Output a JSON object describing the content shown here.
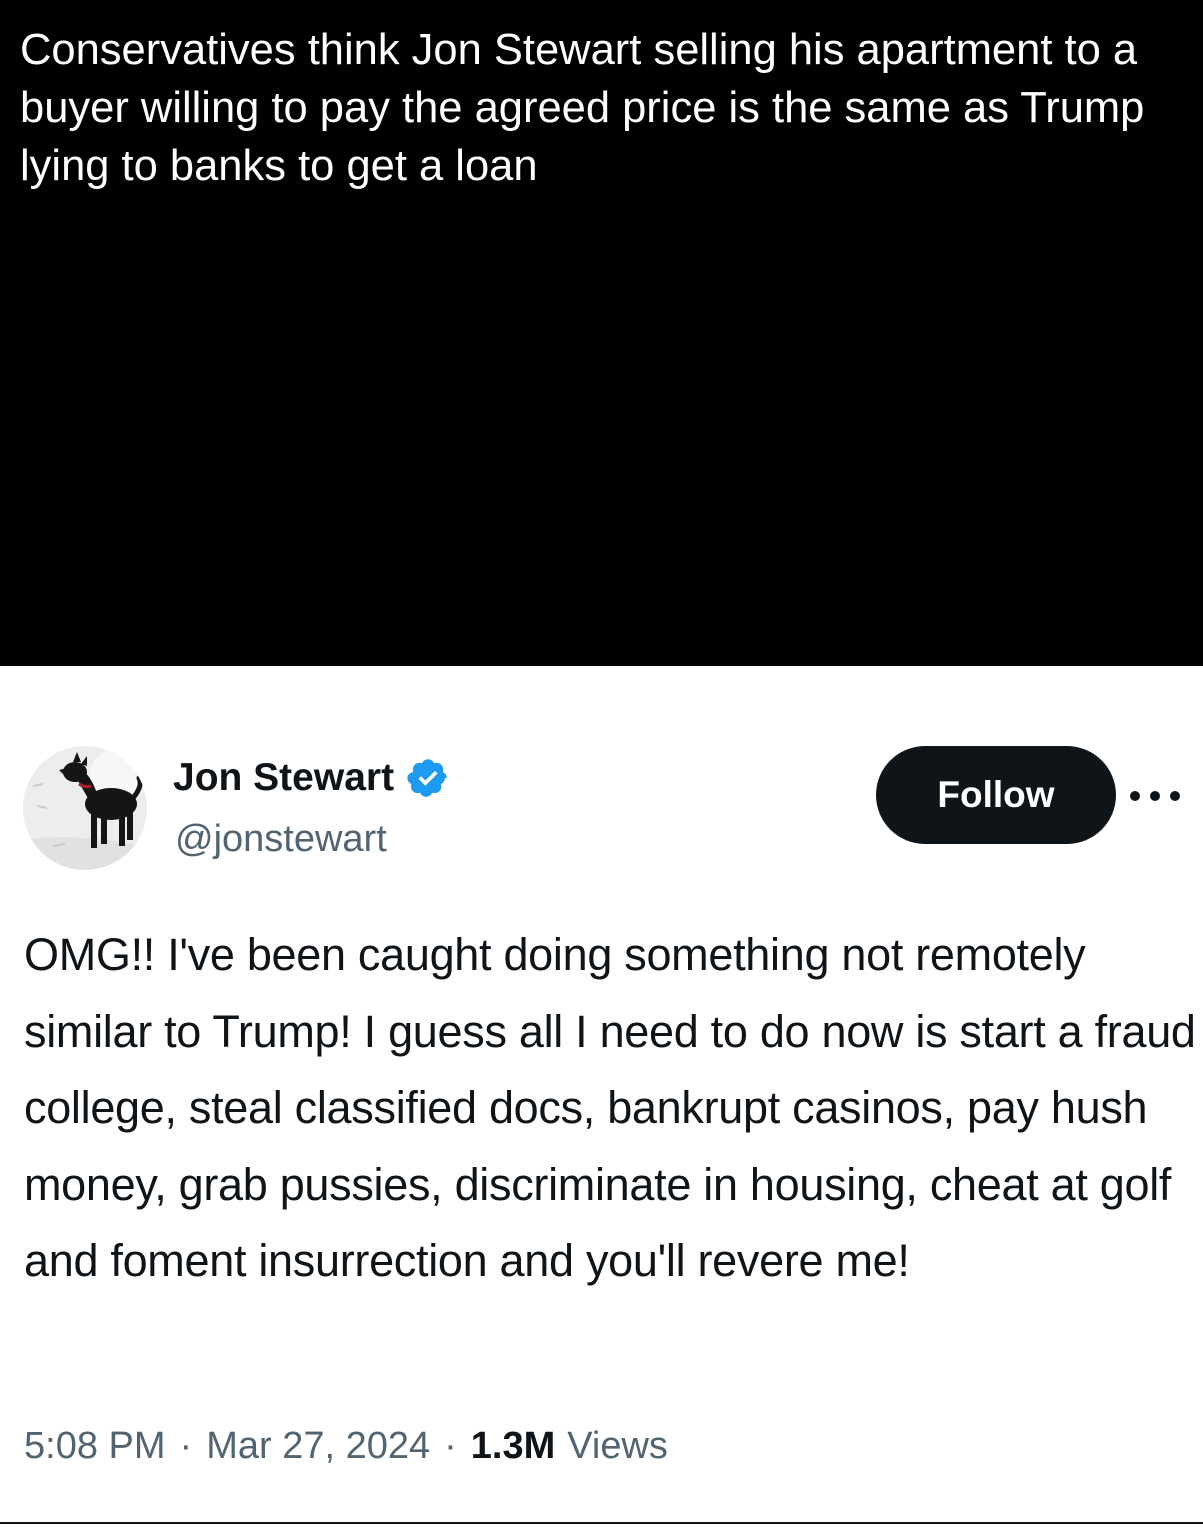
{
  "caption": {
    "text": "Conservatives think Jon Stewart selling his apartment to a buyer willing to pay the agreed price is the same as Trump lying to banks to get a loan"
  },
  "tweet": {
    "author": {
      "display_name": "Jon Stewart",
      "handle": "@jonstewart",
      "verified": true,
      "avatar_icon": "dog-in-snow-avatar",
      "verified_icon": "verified-badge-icon"
    },
    "follow_label": "Follow",
    "more_icon": "more-options-icon",
    "text": "OMG!! I've been caught doing something not remotely similar to Trump! I guess all I need to do now is start a fraud college, steal classified docs, bankrupt casinos, pay hush money, grab pussies, discriminate in housing, cheat at golf and foment insurrection and you'll revere me!",
    "meta": {
      "time": "5:08 PM",
      "separator": "·",
      "date": "Mar 27, 2024",
      "views_count": "1.3M",
      "views_label": "Views"
    }
  },
  "colors": {
    "caption_bg": "#000000",
    "caption_text": "#ffffff",
    "primary_text": "#0f1419",
    "secondary_text": "#536471",
    "verified_blue": "#1d9bf0",
    "follow_bg": "#0f1419"
  }
}
